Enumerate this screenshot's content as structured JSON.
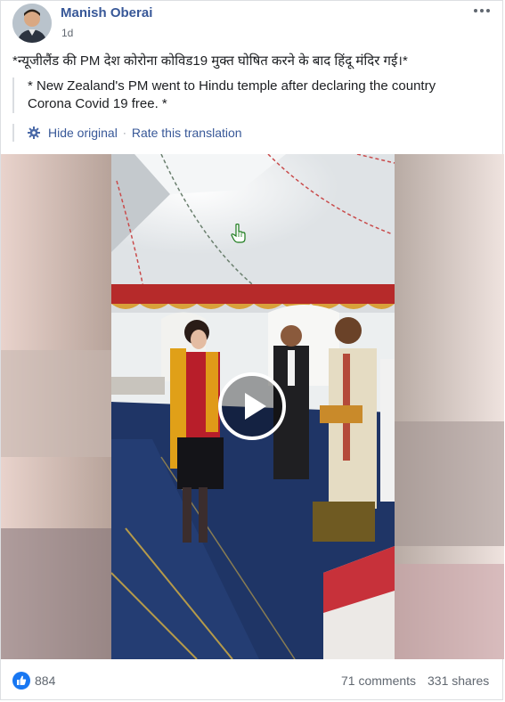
{
  "author": {
    "name": "Manish Oberai",
    "time": "1d"
  },
  "post": {
    "text": "*न्यूजीलैंड की PM देश कोरोना कोविड19 मुक्त घोषित करने के बाद हिंदू मंदिर गई।*",
    "translation_line1": "* New Zealand's PM went to Hindu temple after declaring the country",
    "translation_line2": "Corona Covid 19 free. *",
    "hide_original": "Hide original",
    "separator": "·",
    "rate_translation": "Rate this translation"
  },
  "video": {
    "play_icon": "play-icon",
    "cursor_icon": "hand-cursor-icon"
  },
  "footer": {
    "like_count": "884",
    "comments": "71 comments",
    "shares": "331 shares"
  },
  "colors": {
    "link": "#385898",
    "like_blue": "#1877f2",
    "secondary_text": "#606770"
  }
}
